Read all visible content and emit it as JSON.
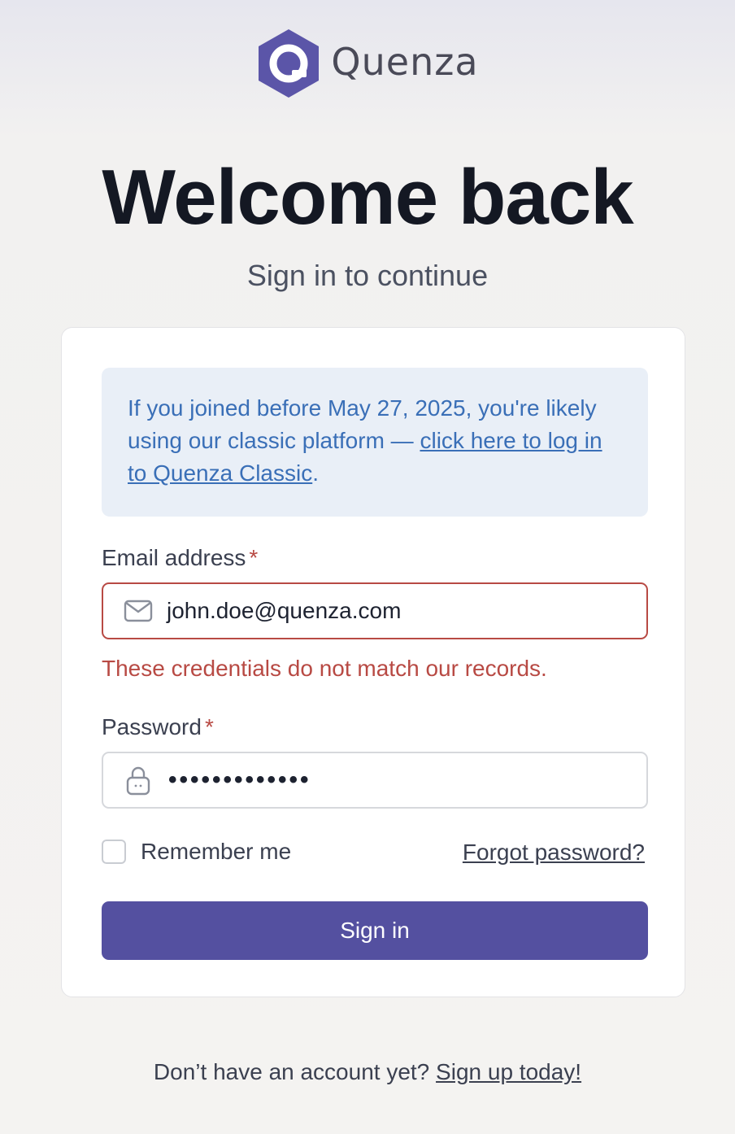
{
  "brand": {
    "name": "Quenza",
    "logo_color": "#5b55a8"
  },
  "header": {
    "title": "Welcome back",
    "subtitle": "Sign in to continue"
  },
  "notice": {
    "text_before": "If you joined before May 27, 2025, you're likely using our classic platform — ",
    "link_text": "click here to log in to Quenza Classic",
    "text_after": "."
  },
  "form": {
    "email": {
      "label": "Email address",
      "required_marker": "*",
      "value": "john.doe@quenza.com",
      "icon": "envelope-icon",
      "error": "These credentials do not match our records."
    },
    "password": {
      "label": "Password",
      "required_marker": "*",
      "masked_value": "•••••••••••••",
      "icon": "lock-icon"
    },
    "remember_label": "Remember me",
    "forgot_label": "Forgot password?",
    "submit_label": "Sign in"
  },
  "footer": {
    "prompt": "Don’t have an account yet?",
    "link_text": "Sign up today!"
  },
  "colors": {
    "primary": "#5450a0",
    "error": "#b84a44",
    "notice_bg": "#e9eff7",
    "notice_text": "#3a6fb7"
  }
}
